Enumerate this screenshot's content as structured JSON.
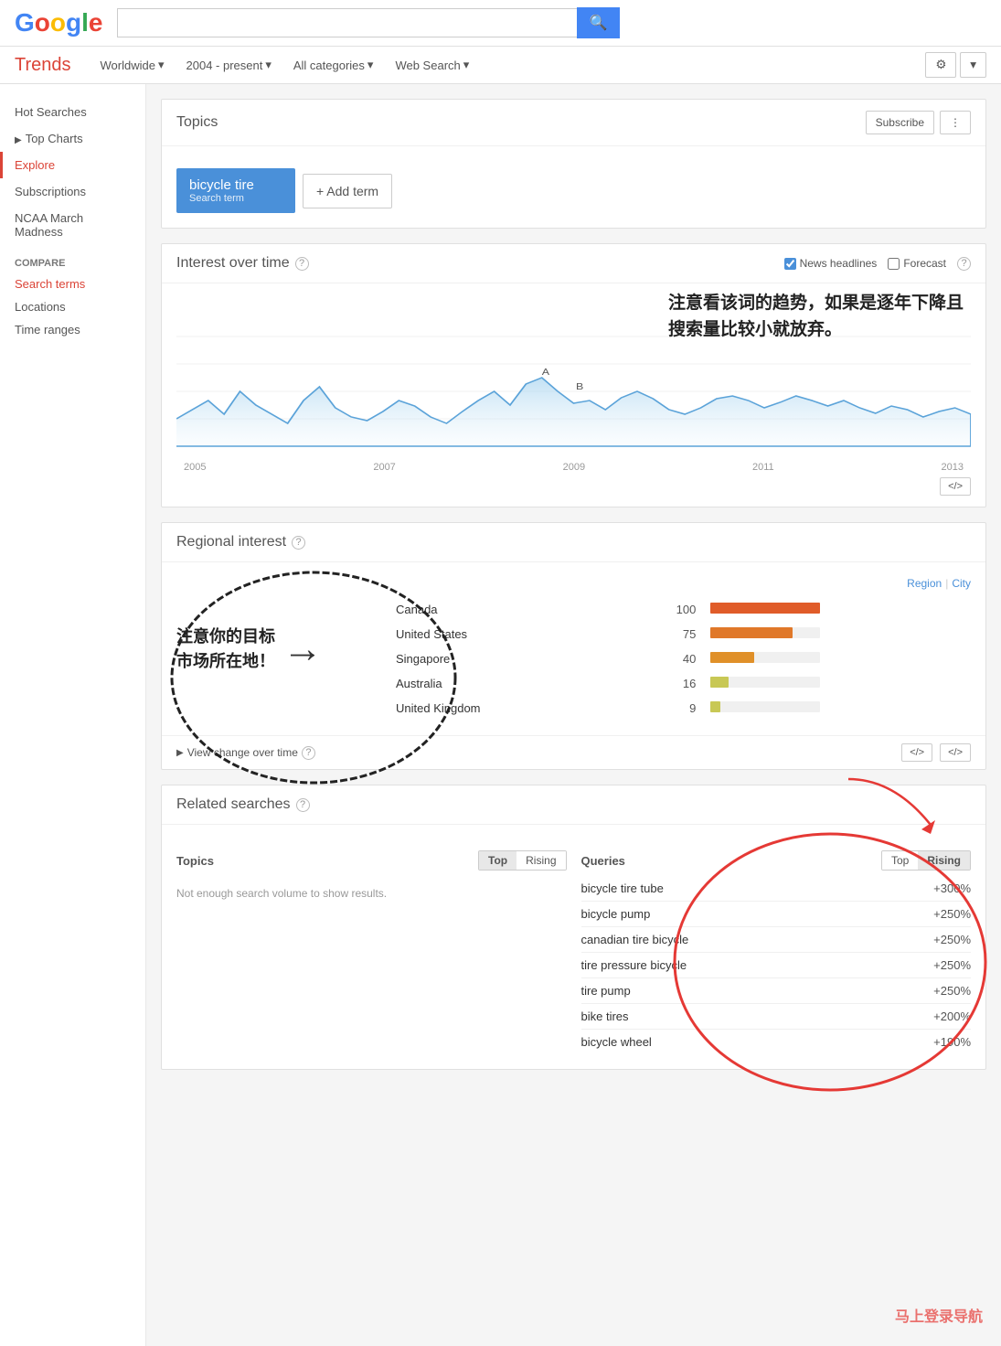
{
  "header": {
    "logo_letters": [
      "G",
      "o",
      "o",
      "g",
      "l",
      "e"
    ],
    "logo_colors": [
      "#4285f4",
      "#ea4335",
      "#fbbc05",
      "#4285f4",
      "#34a853",
      "#ea4335"
    ],
    "search_placeholder": ""
  },
  "toolbar": {
    "trends_label": "Trends",
    "worldwide_label": "Worldwide",
    "date_label": "2004 - present",
    "categories_label": "All categories",
    "web_search_label": "Web Search"
  },
  "sidebar": {
    "hot_searches": "Hot Searches",
    "top_charts": "Top Charts",
    "explore": "Explore",
    "subscriptions": "Subscriptions",
    "ncaa": "NCAA March Madness",
    "compare_label": "Compare",
    "search_terms": "Search terms",
    "locations": "Locations",
    "time_ranges": "Time ranges"
  },
  "topics": {
    "title": "Topics",
    "subscribe_label": "Subscribe",
    "share_label": "⋮",
    "term": "bicycle tire",
    "term_type": "Search term",
    "add_term_label": "+ Add term"
  },
  "interest_over_time": {
    "title": "Interest over time",
    "news_headlines_label": "News headlines",
    "forecast_label": "Forecast",
    "annotation_zh_1": "注意看该词的趋势，如果是逐年下降且",
    "annotation_zh_2": "搜索量比较小就放弃。",
    "x_labels": [
      "2005",
      "2007",
      "2009",
      "2011",
      "2013"
    ],
    "embed_label": "</>",
    "chart_points": [
      45,
      60,
      70,
      55,
      80,
      65,
      50,
      40,
      70,
      85,
      60,
      50,
      45,
      55,
      70,
      65,
      50,
      40,
      55,
      70,
      60,
      50,
      80,
      90,
      75,
      60,
      65,
      55,
      70,
      75,
      65,
      55,
      50,
      55,
      65,
      70,
      60,
      55,
      65,
      70,
      60,
      55,
      50,
      55,
      60,
      65,
      55,
      50,
      55,
      60
    ]
  },
  "regional_interest": {
    "title": "Regional interest",
    "tab_region": "Region",
    "tab_city": "City",
    "annotation_zh": "注意你的目标\n市场所在地！",
    "rows": [
      {
        "name": "Canada",
        "value": 100,
        "bar_color": "#e05c29",
        "bar_pct": 100
      },
      {
        "name": "United States",
        "value": 75,
        "bar_color": "#e07829",
        "bar_pct": 75
      },
      {
        "name": "Singapore",
        "value": 40,
        "bar_color": "#e09029",
        "bar_pct": 40
      },
      {
        "name": "Australia",
        "value": 16,
        "bar_color": "#c8c855",
        "bar_pct": 16
      },
      {
        "name": "United Kingdom",
        "value": 9,
        "bar_color": "#c8c855",
        "bar_pct": 9
      }
    ],
    "view_change_label": "View change over time",
    "embed_label": "</>",
    "embed_label2": "</>"
  },
  "related_searches": {
    "title": "Related searches",
    "topics_label": "Topics",
    "queries_label": "Queries",
    "top_label": "Top",
    "rising_label": "Rising",
    "no_data": "Not enough search volume to show results.",
    "queries_rows": [
      {
        "name": "bicycle tire tube",
        "pct": "+300%"
      },
      {
        "name": "bicycle pump",
        "pct": "+250%"
      },
      {
        "name": "canadian tire bicycle",
        "pct": "+250%"
      },
      {
        "name": "tire pressure bicycle",
        "pct": "+250%"
      },
      {
        "name": "tire pump",
        "pct": "+250%"
      },
      {
        "name": "bike tires",
        "pct": "+200%"
      },
      {
        "name": "bicycle wheel",
        "pct": "+190%"
      }
    ]
  },
  "watermark": "马上登录导航"
}
